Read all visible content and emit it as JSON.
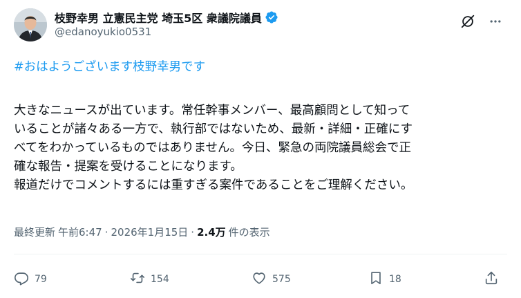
{
  "author": {
    "display_name": "枝野幸男 立憲民主党 埼玉5区 衆議院議員",
    "handle": "@edanoyukio0531"
  },
  "post": {
    "hashtag": "#おはようございます枝野幸男です",
    "lines": [
      "大きなニュースが出ています。常任幹事メンバー、最高顧問として知って",
      "いることが諸々ある一方で、執行部ではないため、最新・詳細・正確にす",
      "べてをわかっているものではありません。今日、緊急の両院議員総会で正",
      "確な報告・提案を受けることになります。",
      "報道だけでコメントするには重すぎる案件であることをご理解ください。"
    ]
  },
  "meta": {
    "updated_label": "最終更新",
    "time": "午前6:47",
    "separator": "·",
    "date": "2026年1月15日",
    "views": "2.4万",
    "views_label": "件の表示"
  },
  "actions": {
    "replies": "79",
    "reposts": "154",
    "likes": "575",
    "bookmarks": "18"
  },
  "colors": {
    "hashtag": "#1d9bf0",
    "verified": "#1d9bf0",
    "secondary_text": "#536471",
    "primary_text": "#0f1419"
  },
  "icons": {
    "avatar": "avatar",
    "verified": "verified-badge-icon",
    "grok": "grok-icon",
    "more": "more-icon",
    "reply": "reply-icon",
    "repost": "repost-icon",
    "like": "heart-icon",
    "bookmark": "bookmark-icon",
    "share": "share-icon"
  }
}
